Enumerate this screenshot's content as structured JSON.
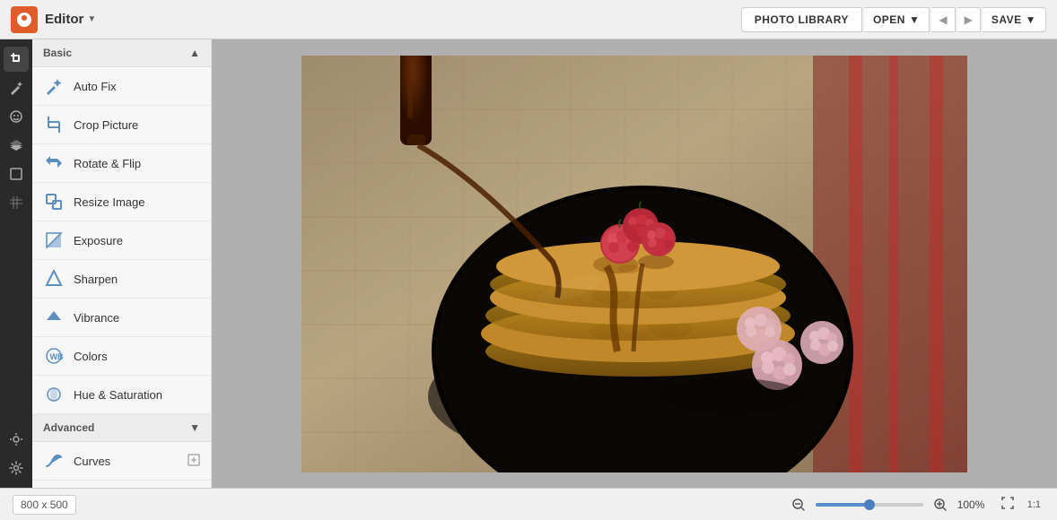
{
  "app": {
    "title": "Editor",
    "logo_letter": "P"
  },
  "topbar": {
    "photo_library_label": "PHOTO LIBRARY",
    "open_label": "OPEN",
    "save_label": "SAVE"
  },
  "sidebar": {
    "basic_section": "Basic",
    "advanced_section": "Advanced",
    "items_basic": [
      {
        "id": "auto-fix",
        "label": "Auto Fix"
      },
      {
        "id": "crop-picture",
        "label": "Crop Picture"
      },
      {
        "id": "rotate-flip",
        "label": "Rotate & Flip"
      },
      {
        "id": "resize-image",
        "label": "Resize Image"
      },
      {
        "id": "exposure",
        "label": "Exposure"
      },
      {
        "id": "sharpen",
        "label": "Sharpen"
      },
      {
        "id": "vibrance",
        "label": "Vibrance"
      },
      {
        "id": "colors",
        "label": "Colors"
      },
      {
        "id": "hue-saturation",
        "label": "Hue & Saturation"
      }
    ],
    "items_advanced": [
      {
        "id": "curves",
        "label": "Curves",
        "has_extra": true
      }
    ]
  },
  "canvas": {
    "zoom_percent": "100%",
    "dimensions": "800 x 500"
  },
  "statusbar": {
    "dimensions": "800 x 500",
    "zoom": "100%",
    "ratio": "1:1"
  }
}
